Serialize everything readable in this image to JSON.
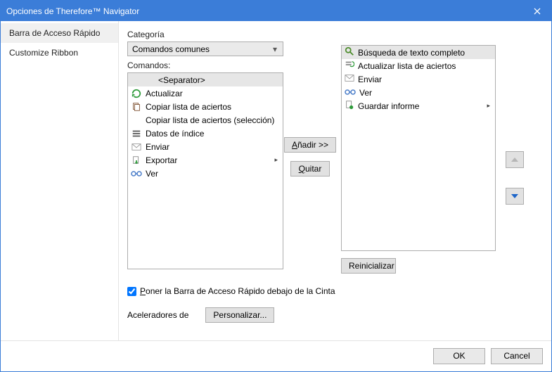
{
  "title": "Opciones de Therefore™ Navigator",
  "sidebar": {
    "items": [
      {
        "label": "Barra de Acceso Rápido"
      },
      {
        "label": "Customize Ribbon"
      }
    ]
  },
  "category_label": "Categoría",
  "category_value": "Comandos comunes",
  "commands_label": "Comandos:",
  "commands": [
    {
      "label": "<Separator>",
      "icon": "",
      "selected": true
    },
    {
      "label": "Actualizar",
      "icon": "refresh"
    },
    {
      "label": "Copiar lista de aciertos",
      "icon": "copy"
    },
    {
      "label": "Copiar lista de aciertos (selección)",
      "icon": ""
    },
    {
      "label": "Datos de índice",
      "icon": "index"
    },
    {
      "label": "Enviar",
      "icon": "mail"
    },
    {
      "label": "Exportar",
      "icon": "export",
      "submenu": true
    },
    {
      "label": "Ver",
      "icon": "view"
    }
  ],
  "add_label": "Añadir >>",
  "remove_label": "Quitar",
  "qat": [
    {
      "label": "Búsqueda de texto completo",
      "icon": "search",
      "selected": true
    },
    {
      "label": "Actualizar lista de aciertos",
      "icon": "refresh-list"
    },
    {
      "label": "Enviar",
      "icon": "mail"
    },
    {
      "label": "Ver",
      "icon": "view"
    },
    {
      "label": "Guardar informe",
      "icon": "save-report",
      "submenu": true
    }
  ],
  "reset_label": "Reinicializar",
  "checkbox_label": "Poner la Barra de Acceso Rápido debajo de la Cinta",
  "accel_label": "Aceleradores de",
  "customize_label": "Personalizar...",
  "ok_label": "OK",
  "cancel_label": "Cancel"
}
